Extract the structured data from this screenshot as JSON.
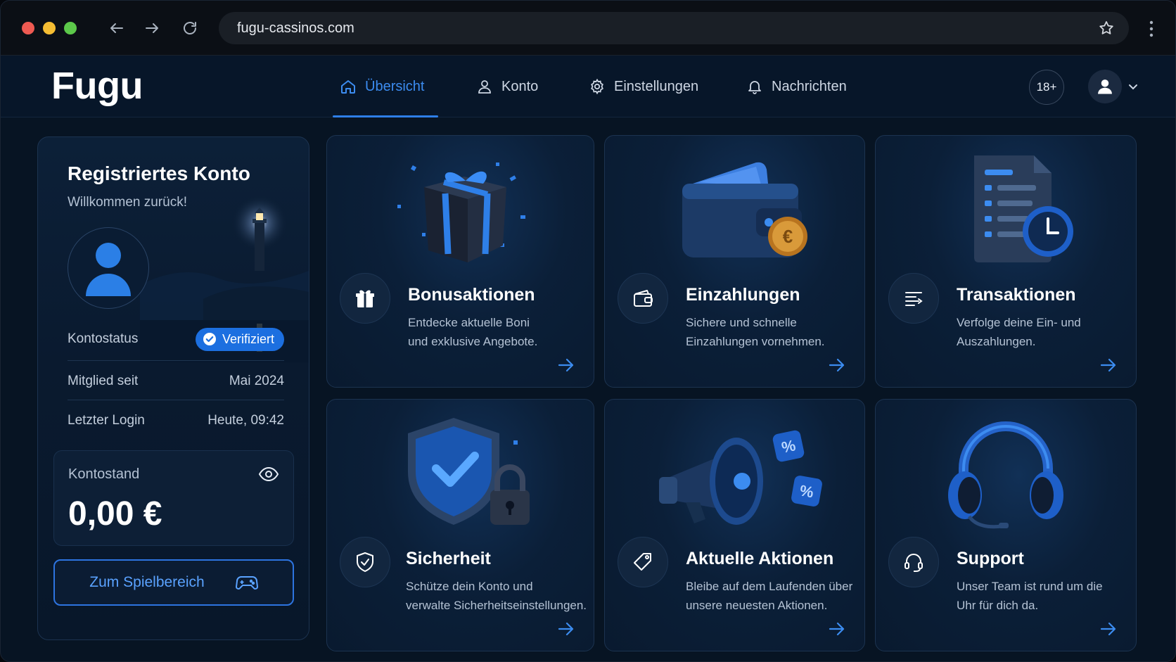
{
  "browser": {
    "url": "fugu-cassinos.com"
  },
  "header": {
    "logo": "Fugu",
    "tabs": [
      {
        "label": "Übersicht",
        "icon": "home-icon",
        "active": true
      },
      {
        "label": "Konto",
        "icon": "user-icon",
        "active": false
      },
      {
        "label": "Einstellungen",
        "icon": "gear-icon",
        "active": false
      },
      {
        "label": "Nachrichten",
        "icon": "bell-icon",
        "active": false
      }
    ],
    "age_badge": "18+"
  },
  "account": {
    "title": "Registriertes Konto",
    "welcome": "Willkommen zurück!",
    "status_label": "Kontostatus",
    "status_value": "Verifiziert",
    "member_label": "Mitglied seit",
    "member_value": "Mai 2024",
    "login_label": "Letzter Login",
    "login_value": "Heute, 09:42",
    "balance_label": "Kontostand",
    "balance_value": "0,00 €",
    "play_button": "Zum Spielbereich"
  },
  "cards": [
    {
      "title": "Bonusaktionen",
      "line1": "Entdecke aktuelle Boni",
      "line2": "und exklusive Angebote.",
      "icon": "gift-icon"
    },
    {
      "title": "Einzahlungen",
      "line1": "Sichere und schnelle",
      "line2": "Einzahlungen vornehmen.",
      "icon": "wallet-icon"
    },
    {
      "title": "Transaktionen",
      "line1": "Verfolge deine Ein- und",
      "line2": "Auszahlungen.",
      "icon": "list-icon"
    },
    {
      "title": "Sicherheit",
      "line1": "Schütze dein Konto und",
      "line2": "verwalte Sicherheitseinstellungen.",
      "icon": "shield-icon"
    },
    {
      "title": "Aktuelle Aktionen",
      "line1": "Bleibe auf dem Laufenden über",
      "line2": "unsere neuesten Aktionen.",
      "icon": "tag-icon"
    },
    {
      "title": "Support",
      "line1": "Unser Team ist rund um die",
      "line2": "Uhr für dich da.",
      "icon": "headset-icon"
    }
  ],
  "colors": {
    "accent": "#2e7fe8",
    "background": "#071423",
    "card": "#0b1f38"
  }
}
